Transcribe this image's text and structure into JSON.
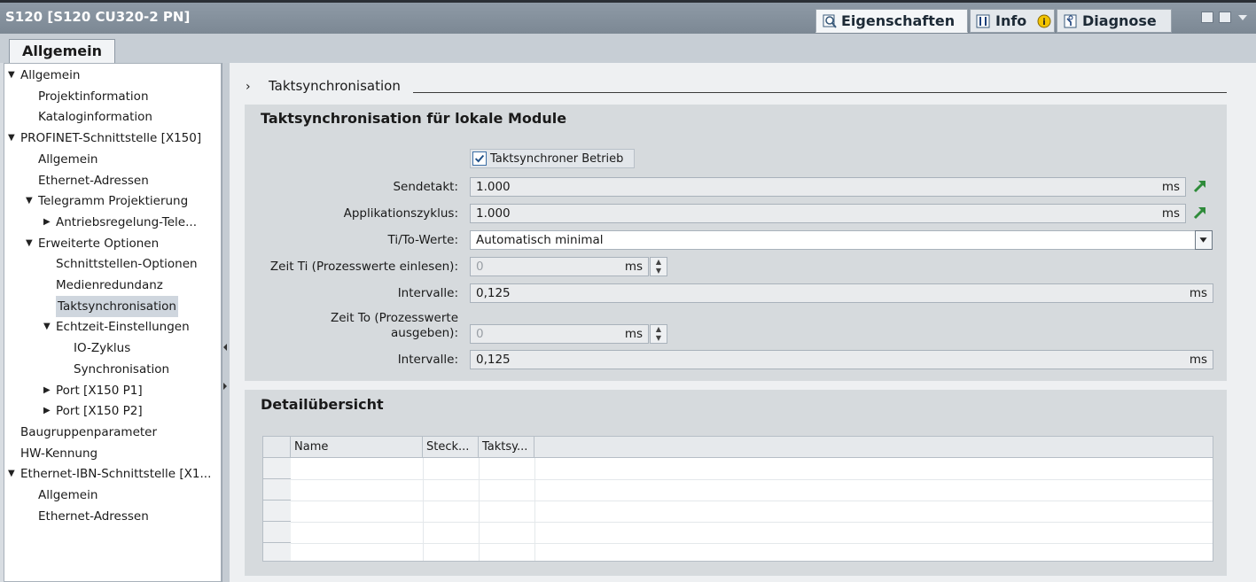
{
  "window": {
    "title": "S120 [S120 CU320-2 PN]",
    "tabs": [
      {
        "label": "Eigenschaften",
        "icon": "properties-icon"
      },
      {
        "label": "Info",
        "icon": "info-icon"
      },
      {
        "label": "Diagnose",
        "icon": "diagnose-icon"
      }
    ]
  },
  "section_tab": "Allgemein",
  "tree": [
    {
      "label": "Allgemein",
      "level": 0,
      "expanded": true
    },
    {
      "label": "Projektinformation",
      "level": 1
    },
    {
      "label": "Kataloginformation",
      "level": 1
    },
    {
      "label": "PROFINET-Schnittstelle [X150]",
      "level": 0,
      "expanded": true
    },
    {
      "label": "Allgemein",
      "level": 1
    },
    {
      "label": "Ethernet-Adressen",
      "level": 1
    },
    {
      "label": "Telegramm Projektierung",
      "level": 1,
      "expanded": true
    },
    {
      "label": "Antriebsregelung-Tele...",
      "level": 2,
      "expanded": false
    },
    {
      "label": "Erweiterte Optionen",
      "level": 1,
      "expanded": true
    },
    {
      "label": "Schnittstellen-Optionen",
      "level": 2
    },
    {
      "label": "Medienredundanz",
      "level": 2
    },
    {
      "label": "Taktsynchronisation",
      "level": 2,
      "selected": true
    },
    {
      "label": "Echtzeit-Einstellungen",
      "level": 2,
      "expanded": true
    },
    {
      "label": "IO-Zyklus",
      "level": 3
    },
    {
      "label": "Synchronisation",
      "level": 3
    },
    {
      "label": "Port [X150 P1]",
      "level": 2,
      "expanded": false
    },
    {
      "label": "Port [X150 P2]",
      "level": 2,
      "expanded": false
    },
    {
      "label": "Baugruppenparameter",
      "level": 0
    },
    {
      "label": "HW-Kennung",
      "level": 0
    },
    {
      "label": "Ethernet-IBN-Schnittstelle [X1...",
      "level": 0,
      "expanded": true
    },
    {
      "label": "Allgemein",
      "level": 1
    },
    {
      "label": "Ethernet-Adressen",
      "level": 1
    }
  ],
  "breadcrumb": "Taktsynchronisation",
  "sync": {
    "title": "Taktsynchronisation für lokale Module",
    "checkbox_label": "Taktsynchroner Betrieb",
    "checkbox_checked": true,
    "sendetakt_label": "Sendetakt:",
    "sendetakt_value": "1.000",
    "applikationszyklus_label": "Applikationszyklus:",
    "applikationszyklus_value": "1.000",
    "tito_label": "Ti/To-Werte:",
    "tito_value": "Automatisch minimal",
    "zeit_ti_label": "Zeit Ti (Prozesswerte einlesen):",
    "zeit_ti_value": "0",
    "intervalle1_label": "Intervalle:",
    "intervalle1_value": "0,125",
    "zeit_to_label_line1": "Zeit To (Prozesswerte",
    "zeit_to_label_line2": "ausgeben):",
    "zeit_to_value": "0",
    "intervalle2_label": "Intervalle:",
    "intervalle2_value": "0,125",
    "unit": "ms"
  },
  "detail": {
    "title": "Detailübersicht",
    "columns": [
      "Name",
      "Steck...",
      "Taktsy..."
    ]
  },
  "colors": {
    "accent": "#2e8b3a",
    "selected": "#cfd6de"
  }
}
